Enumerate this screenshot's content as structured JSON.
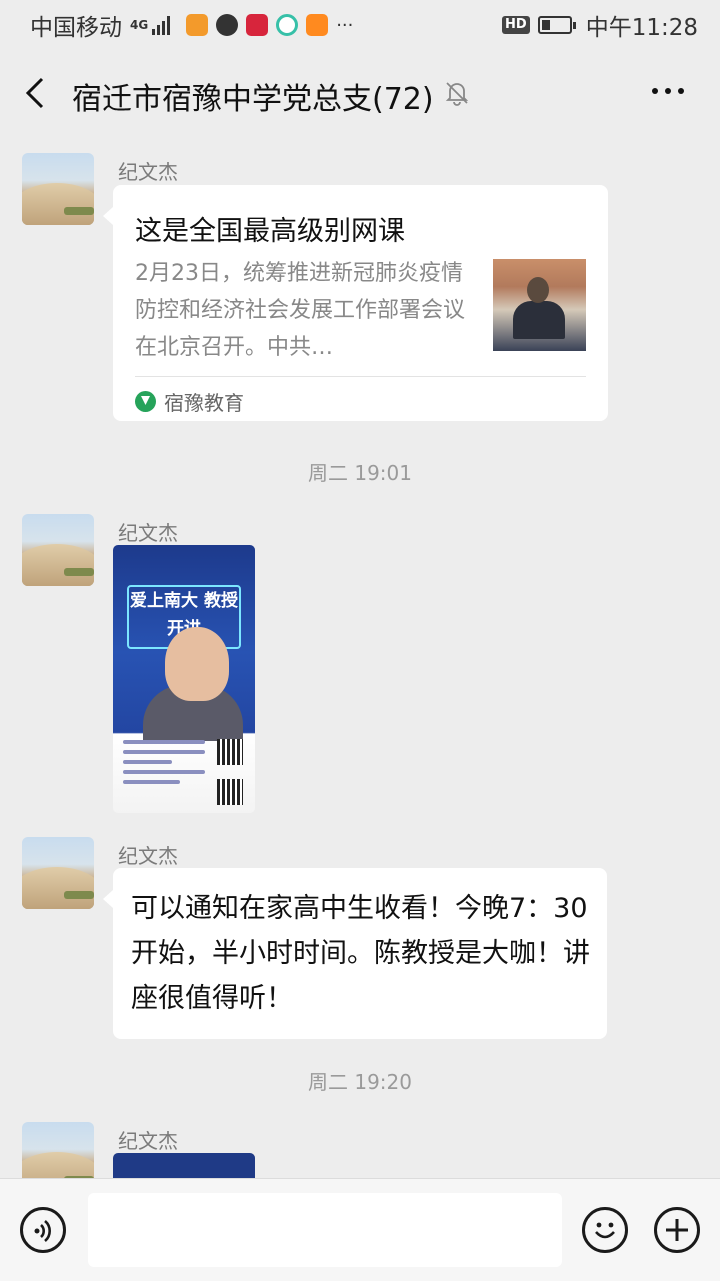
{
  "status_bar": {
    "carrier": "中国移动",
    "network": "4G",
    "more": "···",
    "hd": "HD",
    "time": "中午11:28"
  },
  "header": {
    "title": "宿迁市宿豫中学党总支(72)",
    "back_icon": "chevron-left-icon",
    "mute_icon": "bell-off-icon",
    "more_icon": "more-dots-icon"
  },
  "messages": [
    {
      "sender": "纪文杰",
      "type": "article",
      "title": "这是全国最高级别网课",
      "desc": "2月23日，统筹推进新冠肺炎疫情防控和经济社会发展工作部署会议在北京召开。中共…",
      "source": "宿豫教育"
    },
    {
      "timestamp": "周二 19:01"
    },
    {
      "sender": "纪文杰",
      "type": "image",
      "poster_title": "爱上南大 教授开讲"
    },
    {
      "sender": "纪文杰",
      "type": "text",
      "text": "可以通知在家高中生收看！今晚7：30开始，半小时时间。陈教授是大咖！讲座很值得听！"
    },
    {
      "timestamp": "周二 19:20"
    },
    {
      "sender": "纪文杰",
      "type": "image"
    }
  ],
  "input_bar": {
    "placeholder": "",
    "voice_icon": "voice-icon",
    "emoji_icon": "emoji-icon",
    "plus_icon": "plus-icon"
  }
}
